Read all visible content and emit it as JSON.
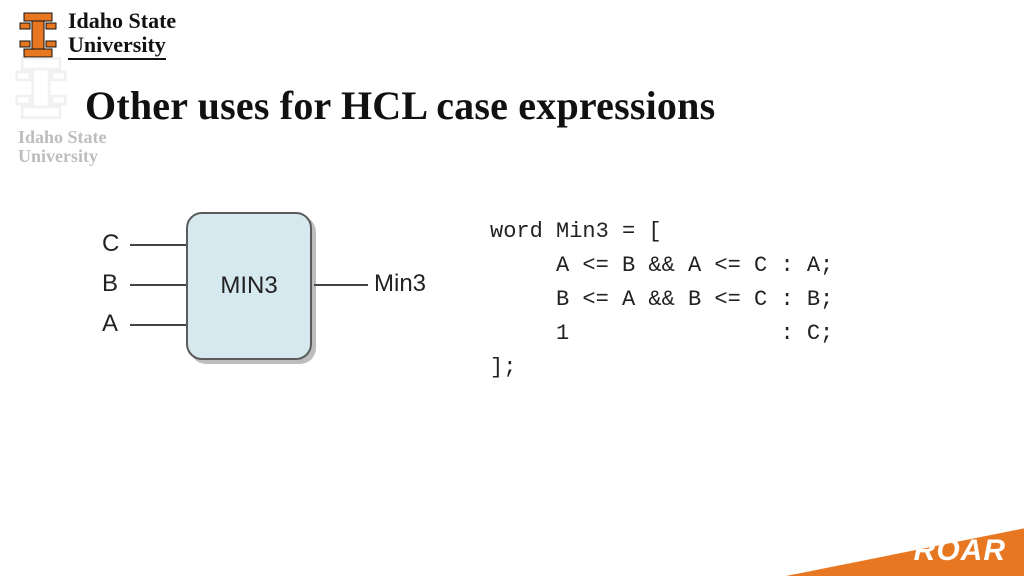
{
  "university": {
    "line1": "Idaho State",
    "line2": "University"
  },
  "ghost": {
    "line1": "Idaho State",
    "line2": "University"
  },
  "title": "Other uses for HCL case expressions",
  "diagram": {
    "block_label": "MIN3",
    "inputs": [
      "C",
      "B",
      "A"
    ],
    "output": "Min3"
  },
  "code": {
    "l1": "word Min3 = [",
    "l2": "     A <= B && A <= C : A;",
    "l3": "     B <= A && B <= C : B;",
    "l4": "     1                : C;",
    "l5": "];"
  },
  "banner": "ROAR",
  "colors": {
    "accent": "#e87722",
    "block_fill": "#d6e9ef"
  }
}
